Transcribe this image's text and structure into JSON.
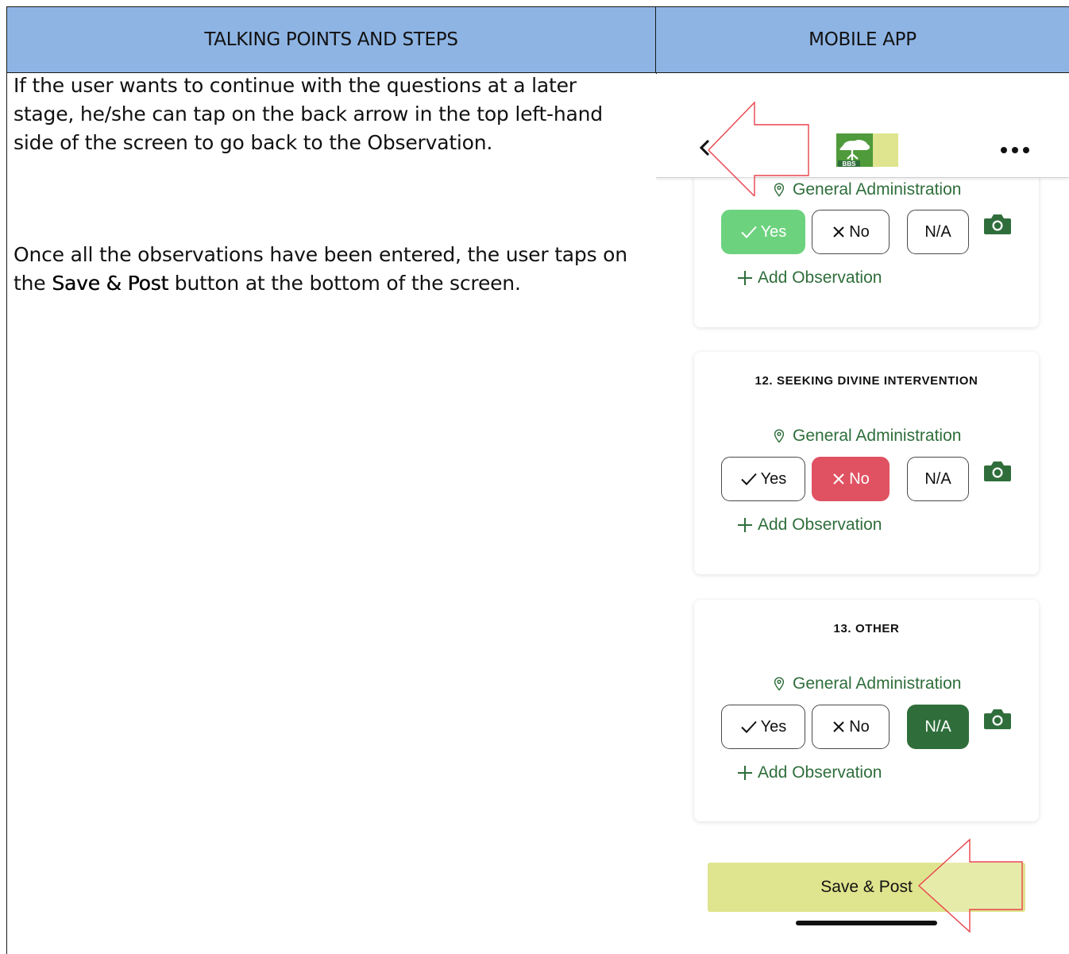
{
  "table": {
    "header_left": "TALKING POINTS AND STEPS",
    "header_right": "MOBILE APP"
  },
  "talking_points": {
    "para1": "If the user wants to continue with the questions at a later stage, he/she can tap on the back arrow in the top left-hand side of the screen to go back to the Observation.",
    "para2_before": "Once all the observations have been entered, the user taps on the ",
    "para2_bold": "Save & Post",
    "para2_after": " button at the bottom of the screen."
  },
  "app": {
    "logo_text": "BBS",
    "cards": [
      {
        "title": "",
        "location": "General Administration",
        "yes_label": "Yes",
        "no_label": "No",
        "na_label": "N/A",
        "selected": "yes",
        "add_observation": "Add Observation"
      },
      {
        "title": "12. SEEKING DIVINE INTERVENTION",
        "location": "General Administration",
        "yes_label": "Yes",
        "no_label": "No",
        "na_label": "N/A",
        "selected": "no",
        "add_observation": "Add Observation"
      },
      {
        "title": "13. OTHER",
        "location": "General Administration",
        "yes_label": "Yes",
        "no_label": "No",
        "na_label": "N/A",
        "selected": "na",
        "add_observation": "Add Observation"
      }
    ],
    "save_button": "Save & Post"
  },
  "colors": {
    "header_bg": "#8eb4e3",
    "brand_green": "#2f6e3b",
    "yes_selected": "#6dd27e",
    "no_selected": "#e05262",
    "save_bg": "#dfe48e",
    "annotation_arrow": "#e8434b"
  },
  "icons": [
    "back-chevron-icon",
    "bbs-logo",
    "more-dots-icon",
    "location-pin-icon",
    "check-icon",
    "cross-icon",
    "camera-icon",
    "plus-icon",
    "annotation-arrow-icon"
  ]
}
